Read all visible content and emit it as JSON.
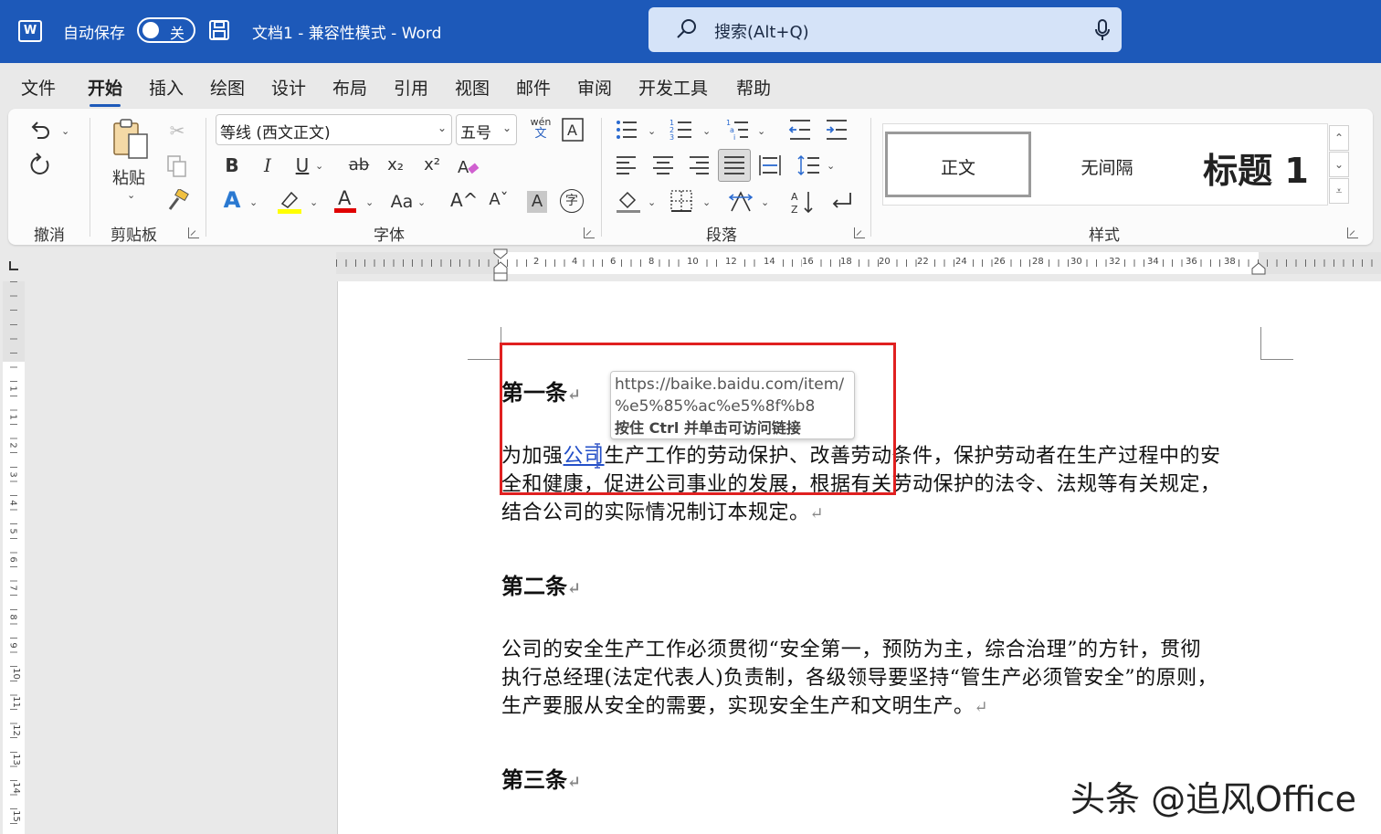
{
  "titlebar": {
    "logo": "W",
    "autosave_label": "自动保存",
    "autosave_state": "关",
    "doc_title": "文档1  -  兼容性模式  -  Word",
    "search_placeholder": "搜索(Alt+Q)",
    "accent": "#1d59b9"
  },
  "menu": {
    "tabs": [
      "文件",
      "开始",
      "插入",
      "绘图",
      "设计",
      "布局",
      "引用",
      "视图",
      "邮件",
      "审阅",
      "开发工具",
      "帮助"
    ],
    "active": "开始"
  },
  "ribbon": {
    "groups": {
      "undo": "撤消",
      "clipboard": "剪贴板",
      "font": "字体",
      "paragraph": "段落",
      "styles": "样式"
    },
    "paste_label": "粘贴",
    "font_name": "等线 (西文正文)",
    "font_size": "五号",
    "phonetic_label": "wén",
    "phonetic_sub": "文",
    "buttons": {
      "bold": "B",
      "italic": "I",
      "underline": "U",
      "strike": "ab",
      "subscript": "x₂",
      "superscript": "x²",
      "font_color": "A",
      "change_case": "Aa",
      "grow": "A^",
      "shrink": "Aˇ",
      "char_shading": "A",
      "enclose": "字",
      "text_effect": "A"
    },
    "styles": [
      "正文",
      "无间隔",
      "标题 1"
    ],
    "highlight_color": "#ffff00",
    "font_color_bar": "#e00000"
  },
  "ruler": {
    "numbers": [
      "2",
      "4",
      "6",
      "8",
      "10",
      "12",
      "14",
      "16",
      "18",
      "20",
      "22",
      "24",
      "26",
      "28",
      "30",
      "32",
      "34",
      "36",
      "38"
    ],
    "vnumbers": [
      "1",
      "1",
      "2",
      "3",
      "4",
      "5",
      "6",
      "7",
      "8",
      "9",
      "10",
      "11",
      "12",
      "13",
      "14",
      "15",
      "16"
    ]
  },
  "document": {
    "h1": "第一条",
    "p1_before_link": "为加强",
    "p1_link": "公司",
    "p1_line1_after": "生产工作的劳动保护、改善劳动条件，保护劳动者在生产过程中的安",
    "p1_line2": "全和健康，促进公司事业的发展，根据有关劳动保护的法令、法规等有关规定，",
    "p1_line3": "结合公司的实际情况制订本规定。",
    "h2": "第二条",
    "p2_line1": "公司的安全生产工作必须贯彻“安全第一，预防为主，综合治理”的方针，贯彻",
    "p2_line2": "执行总经理(法定代表人)负责制，各级领导要坚持“管生产必须管安全”的原则，",
    "p2_line3": "生产要服从安全的需要，实现安全生产和文明生产。",
    "h3": "第三条",
    "para_mark": "↵"
  },
  "tooltip": {
    "url_line1": "https://baike.baidu.com/item/",
    "url_line2": "%e5%85%ac%e5%8f%b8",
    "hint": "按住 Ctrl 并单击可访问链接"
  },
  "watermark": "头条 @追风Office"
}
